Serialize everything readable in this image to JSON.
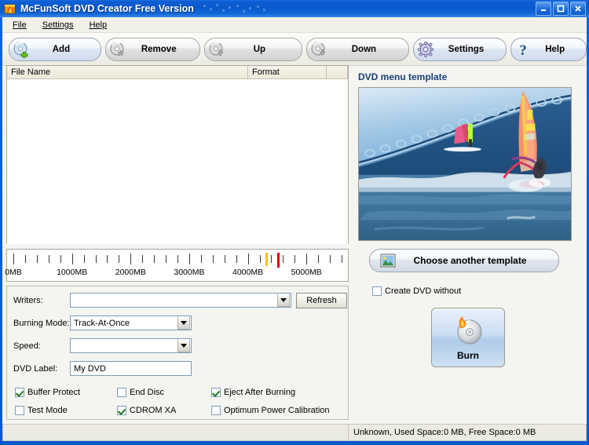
{
  "window": {
    "title": "McFunSoft DVD Creator Free Version",
    "icon": "app-flame-icon",
    "controls": {
      "minimize": "minimize-button",
      "maximize": "maximize-button",
      "close": "close-button"
    },
    "titlebar_color": "#0a58cc"
  },
  "menu": {
    "items": [
      {
        "label": "File",
        "accel": "F"
      },
      {
        "label": "Settings",
        "accel": "S"
      },
      {
        "label": "Help",
        "accel": "H"
      }
    ]
  },
  "toolbar": {
    "buttons": [
      {
        "label": "Add",
        "icon": "disc-add-icon",
        "style": "blue"
      },
      {
        "label": "Remove",
        "icon": "disc-remove-icon",
        "style": "gray"
      },
      {
        "label": "Up",
        "icon": "disc-up-icon",
        "style": "gray"
      },
      {
        "label": "Down",
        "icon": "disc-down-icon",
        "style": "gray"
      },
      {
        "label": "Settings",
        "icon": "gear-icon",
        "style": "blue"
      },
      {
        "label": "Help",
        "icon": "question-mark-icon",
        "style": "blue"
      }
    ]
  },
  "file_list": {
    "columns": [
      "File Name",
      "Format",
      ""
    ],
    "rows": []
  },
  "chart_data": {
    "type": "bar",
    "title": "Disc capacity ruler",
    "xlabel": "",
    "ylabel": "",
    "xlim": [
      0,
      5600
    ],
    "grid": false,
    "tick_step": 200,
    "tick_labels": [
      "0MB",
      "1000MB",
      "2000MB",
      "3000MB",
      "4000MB",
      "5000MB"
    ],
    "tick_label_values": [
      0,
      1000,
      2000,
      3000,
      4000,
      5000
    ],
    "markers": [
      {
        "name": "dvd-capacity-warning",
        "value": 4300,
        "color": "#ffc000"
      },
      {
        "name": "dvd-capacity-limit",
        "value": 4500,
        "color": "#d40000"
      }
    ],
    "used_value": 0
  },
  "burner": {
    "writers": {
      "label": "Writers:",
      "value": "",
      "placeholder": ""
    },
    "refresh_button": "Refresh",
    "burning_mode": {
      "label": "Burning Mode:",
      "value": "Track-At-Once"
    },
    "speed": {
      "label": "Speed:",
      "value": ""
    },
    "dvd_label": {
      "label": "DVD Label:",
      "value": "My DVD"
    },
    "options": [
      {
        "label": "Buffer Protect",
        "checked": true
      },
      {
        "label": "End Disc",
        "checked": false
      },
      {
        "label": "Eject After Burning",
        "checked": true
      },
      {
        "label": "Test Mode",
        "checked": false
      },
      {
        "label": "CDROM XA",
        "checked": true
      },
      {
        "label": "Optimum Power Calibration",
        "checked": false
      }
    ]
  },
  "template_panel": {
    "title": "DVD menu template",
    "preview_alt": "windsurfing-photo",
    "choose_button": {
      "label": "Choose another template",
      "icon": "picture-icon"
    },
    "create_without": {
      "label": "Create DVD without",
      "checked": false
    },
    "burn_button": {
      "label": "Burn",
      "icon": "burning-disc-icon"
    }
  },
  "status_bar": {
    "left": "",
    "right": "Unknown, Used Space:0 MB, Free Space:0 MB"
  }
}
